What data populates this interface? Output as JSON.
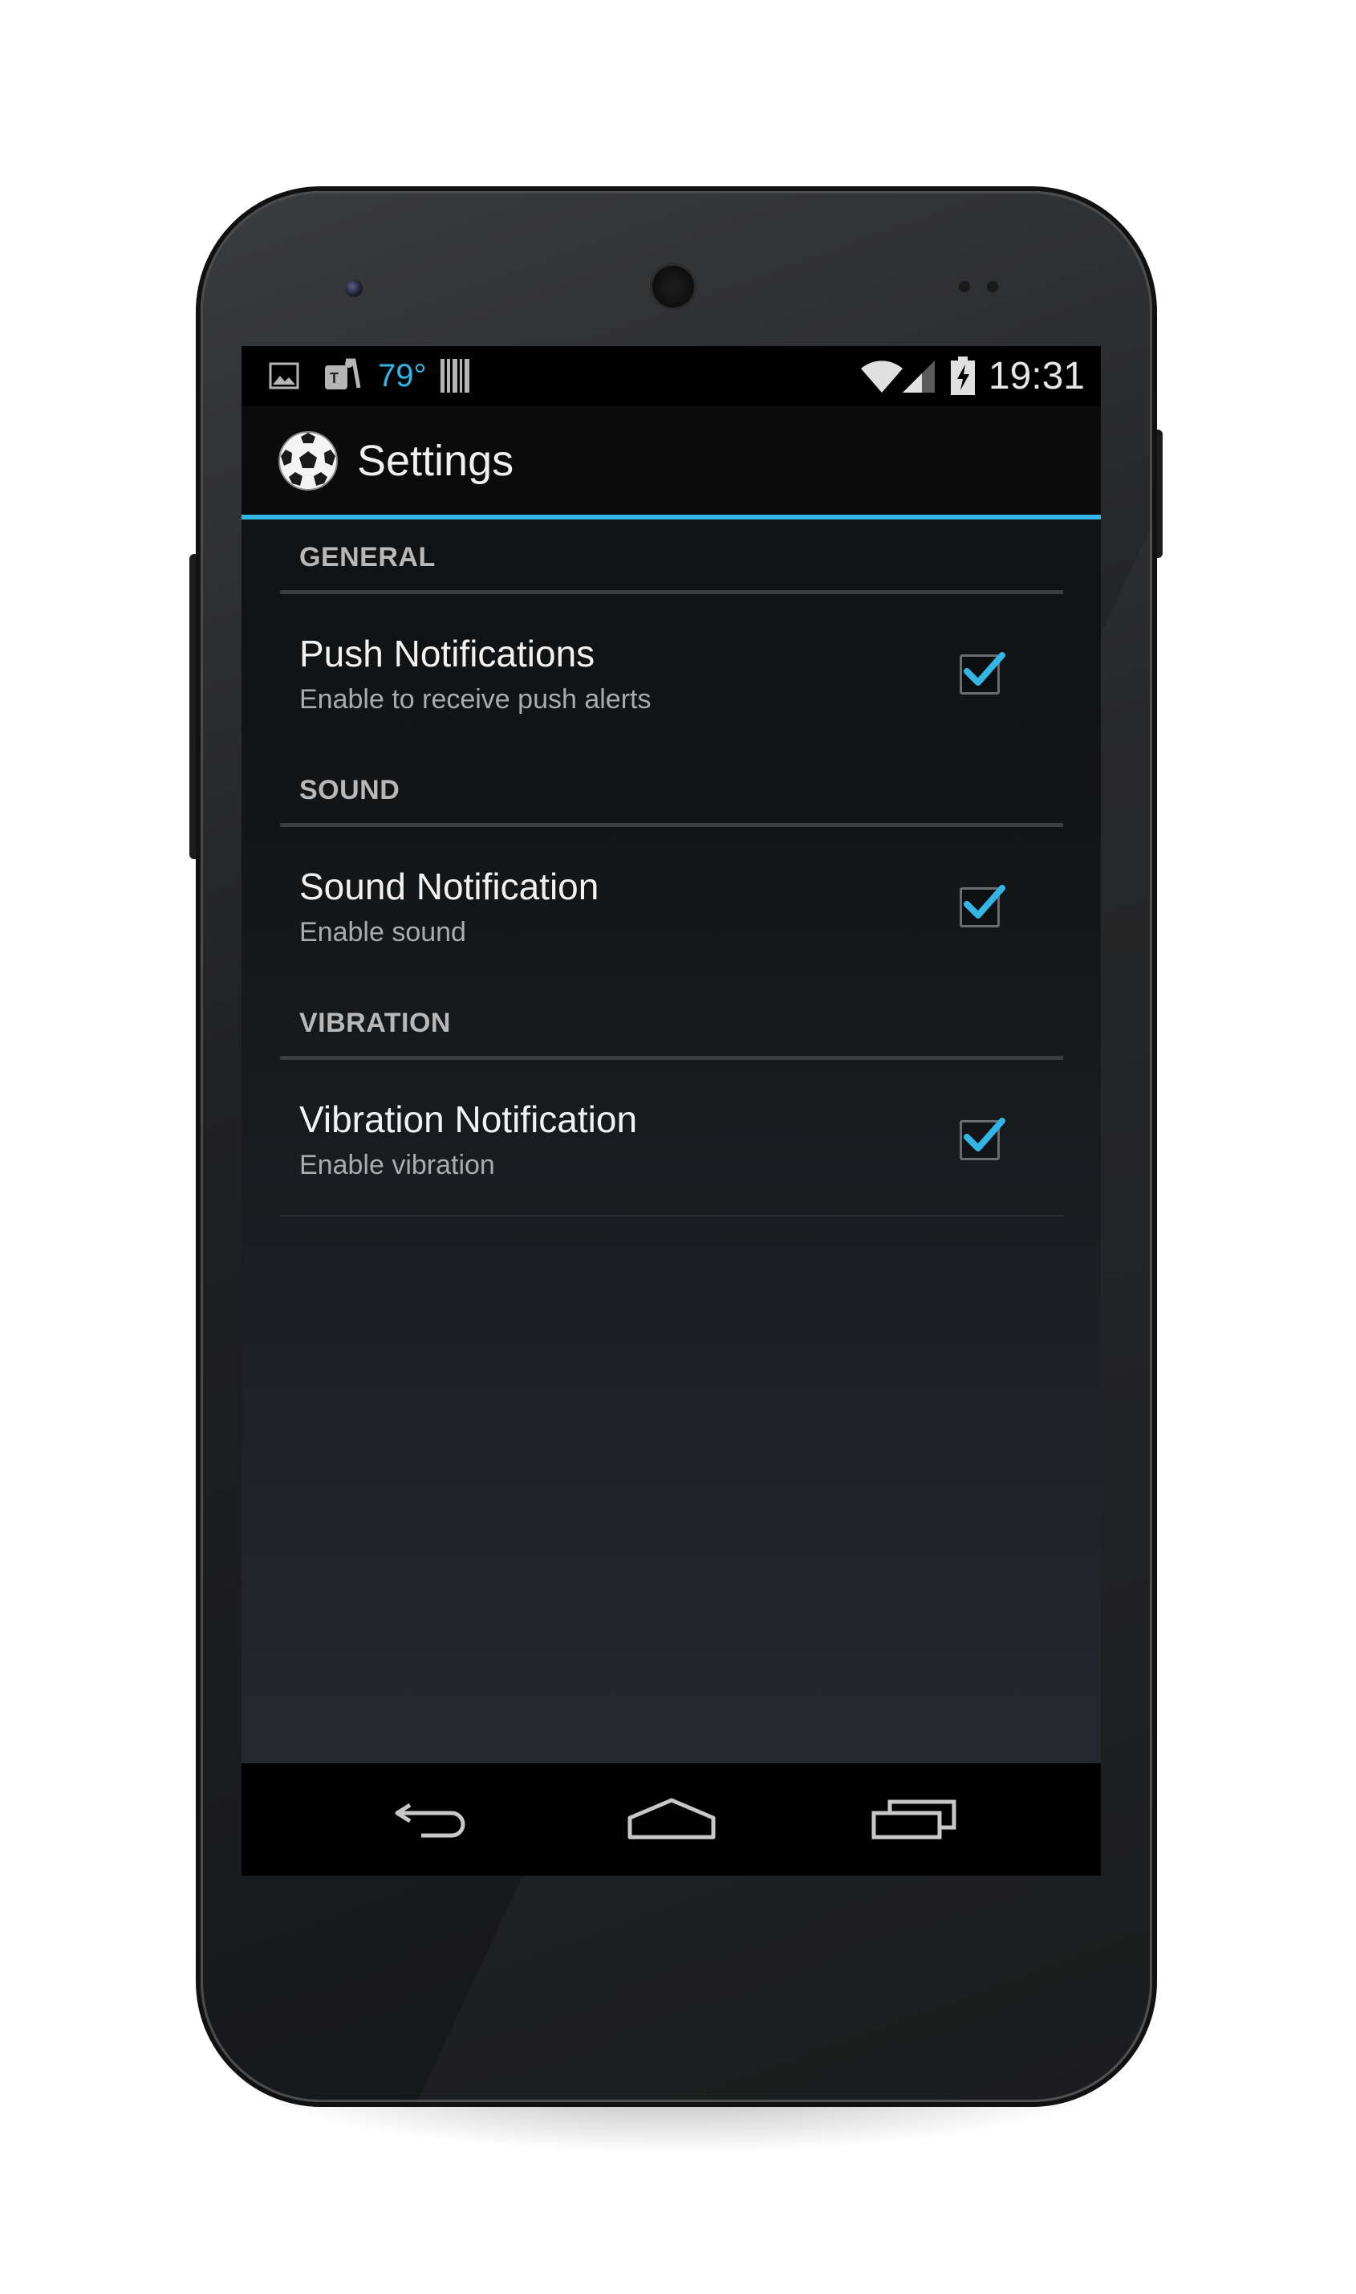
{
  "status_bar": {
    "temperature": "79°",
    "time": "19:31",
    "icons": [
      "image-icon",
      "tmobile-icon",
      "barcode-icon",
      "wifi-icon",
      "signal-icon",
      "battery-charging-icon"
    ]
  },
  "action_bar": {
    "title": "Settings",
    "icon": "soccer-ball-icon"
  },
  "categories": [
    {
      "title": "GENERAL",
      "preference": {
        "title": "Push Notifications",
        "summary": "Enable to receive push alerts",
        "checked": true
      }
    },
    {
      "title": "SOUND",
      "preference": {
        "title": "Sound Notification",
        "summary": "Enable sound",
        "checked": true
      }
    },
    {
      "title": "VIBRATION",
      "preference": {
        "title": "Vibration Notification",
        "summary": "Enable vibration",
        "checked": true
      }
    }
  ],
  "nav_bar": {
    "buttons": [
      "back-icon",
      "home-icon",
      "recents-icon"
    ]
  },
  "colors": {
    "accent": "#33b5e5",
    "background": "#121416",
    "text_primary": "#f2f2f2",
    "text_secondary": "#a9abad"
  }
}
